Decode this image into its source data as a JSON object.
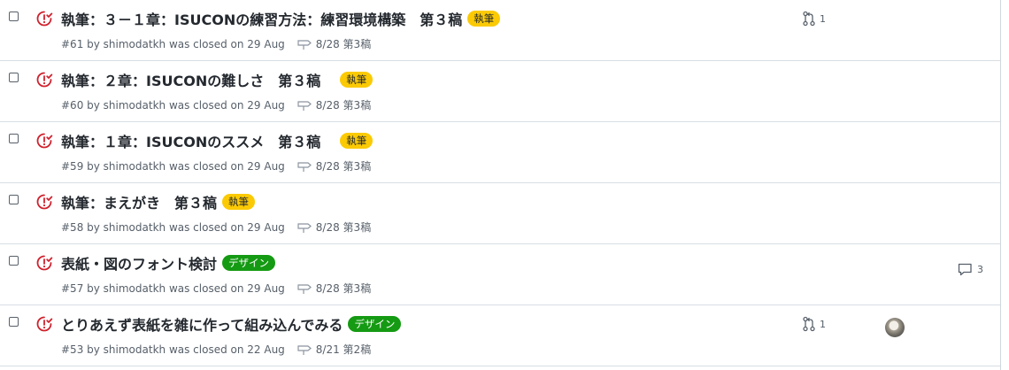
{
  "colors": {
    "closed_icon": "#cf222e",
    "label_shippitsu_bg": "#fbca04",
    "label_design_bg": "#159a13"
  },
  "issues": [
    {
      "title": "執筆：３－１章：ISUCONの練習方法：練習環境構築　第３稿",
      "label": "執筆",
      "label_type": "shippitsu",
      "number_meta": "#61 by shimodatkh was closed on 29 Aug",
      "milestone": "8/28 第3稿",
      "linked_pr_count": "1",
      "comment_count": null,
      "has_avatar": false
    },
    {
      "title": "執筆：２章：ISUCONの難しさ　第３稿　",
      "label": "執筆",
      "label_type": "shippitsu",
      "number_meta": "#60 by shimodatkh was closed on 29 Aug",
      "milestone": "8/28 第3稿",
      "linked_pr_count": null,
      "comment_count": null,
      "has_avatar": false
    },
    {
      "title": "執筆：１章：ISUCONのススメ　第３稿　",
      "label": "執筆",
      "label_type": "shippitsu",
      "number_meta": "#59 by shimodatkh was closed on 29 Aug",
      "milestone": "8/28 第3稿",
      "linked_pr_count": null,
      "comment_count": null,
      "has_avatar": false
    },
    {
      "title": "執筆：まえがき　第３稿",
      "label": "執筆",
      "label_type": "shippitsu",
      "number_meta": "#58 by shimodatkh was closed on 29 Aug",
      "milestone": "8/28 第3稿",
      "linked_pr_count": null,
      "comment_count": null,
      "has_avatar": false
    },
    {
      "title": "表紙・図のフォント検討",
      "label": "デザイン",
      "label_type": "design",
      "number_meta": "#57 by shimodatkh was closed on 29 Aug",
      "milestone": "8/28 第3稿",
      "linked_pr_count": null,
      "comment_count": "3",
      "has_avatar": false
    },
    {
      "title": "とりあえず表紙を雑に作って組み込んでみる",
      "label": "デザイン",
      "label_type": "design",
      "number_meta": "#53 by shimodatkh was closed on 22 Aug",
      "milestone": "8/21 第2稿",
      "linked_pr_count": "1",
      "comment_count": null,
      "has_avatar": true
    }
  ]
}
